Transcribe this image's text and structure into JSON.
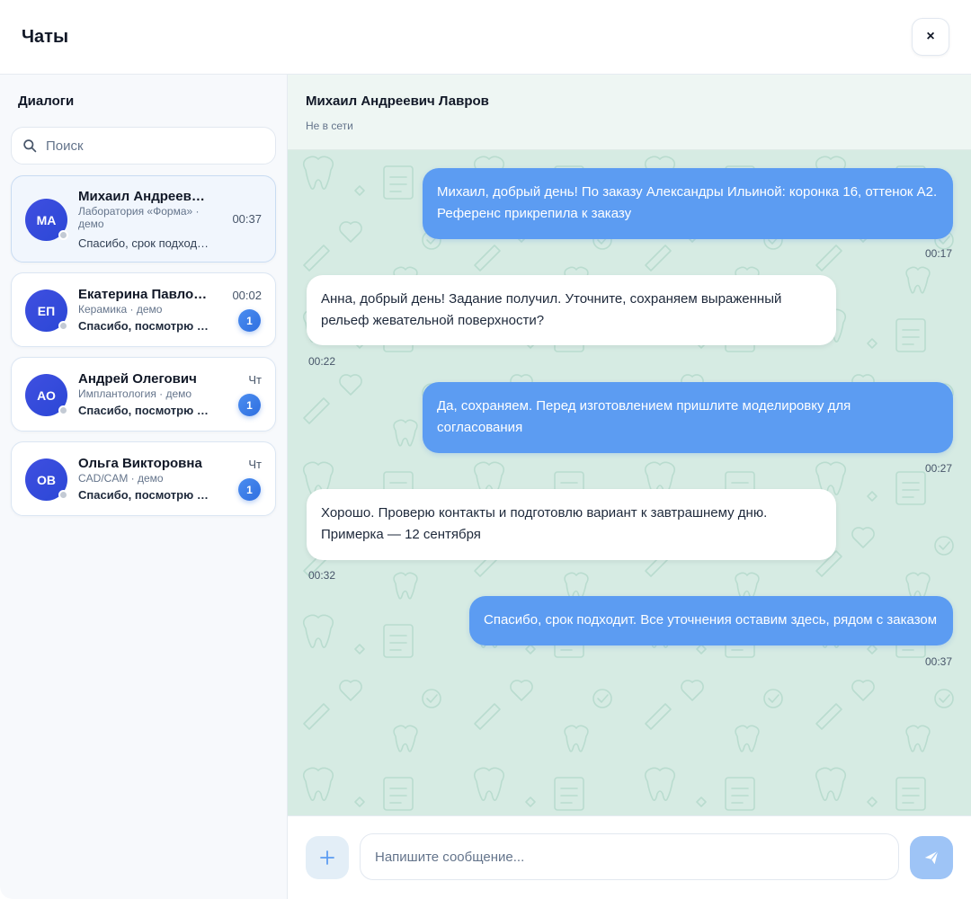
{
  "app": {
    "title": "Чаты",
    "close_label": "×"
  },
  "sidebar": {
    "title": "Диалоги",
    "search_placeholder": "Поиск",
    "dialogs": [
      {
        "initials": "МА",
        "name": "Михаил Андреевич Лавров",
        "subtitle": "Лаборатория «Форма» · демо",
        "preview": "Спасибо, срок подходит. Все уточнения оставим здесь, рядом с заказом",
        "time": "00:37",
        "unread": "",
        "active": true
      },
      {
        "initials": "ЕП",
        "name": "Екатерина Павловна",
        "subtitle": "Керамика · демо",
        "preview": "Спасибо, посмотрю сегодня",
        "time": "00:02",
        "unread": "1",
        "active": false
      },
      {
        "initials": "АО",
        "name": "Андрей Олегович",
        "subtitle": "Имплантология · демо",
        "preview": "Спасибо, посмотрю сегодня",
        "time": "Чт",
        "unread": "1",
        "active": false
      },
      {
        "initials": "ОВ",
        "name": "Ольга Викторовна",
        "subtitle": "CAD/CAM · демо",
        "preview": "Спасибо, посмотрю сегодня",
        "time": "Чт",
        "unread": "1",
        "active": false
      }
    ]
  },
  "chat": {
    "contact_name": "Михаил Андреевич Лавров",
    "contact_status": "Не в сети",
    "messages": [
      {
        "direction": "out",
        "text": "Михаил, добрый день! По заказу Александры Ильиной: коронка 16, оттенок A2. Референс прикрепила к заказу",
        "time": "00:17"
      },
      {
        "direction": "in",
        "text": "Анна, добрый день! Задание получил. Уточните, сохраняем выраженный рельеф жевательной поверхности?",
        "time": "00:22"
      },
      {
        "direction": "out",
        "text": "Да, сохраняем. Перед изготовлением пришлите моделировку для согласования",
        "time": "00:27"
      },
      {
        "direction": "in",
        "text": "Хорошо. Проверю контакты и подготовлю вариант к завтрашнему дню. Примерка — 12 сентября",
        "time": "00:32"
      },
      {
        "direction": "out",
        "text": "Спасибо, срок подходит. Все уточнения оставим здесь, рядом с заказом",
        "time": "00:37"
      }
    ]
  },
  "composer": {
    "placeholder": "Напишите сообщение...",
    "attach_icon": "plus-icon",
    "send_icon": "send-icon"
  },
  "colors": {
    "accent": "#5c9cf2",
    "avatar": "#3f4fe0",
    "chat_background": "#d6ebe3",
    "send_button": "#9ec4f6"
  }
}
